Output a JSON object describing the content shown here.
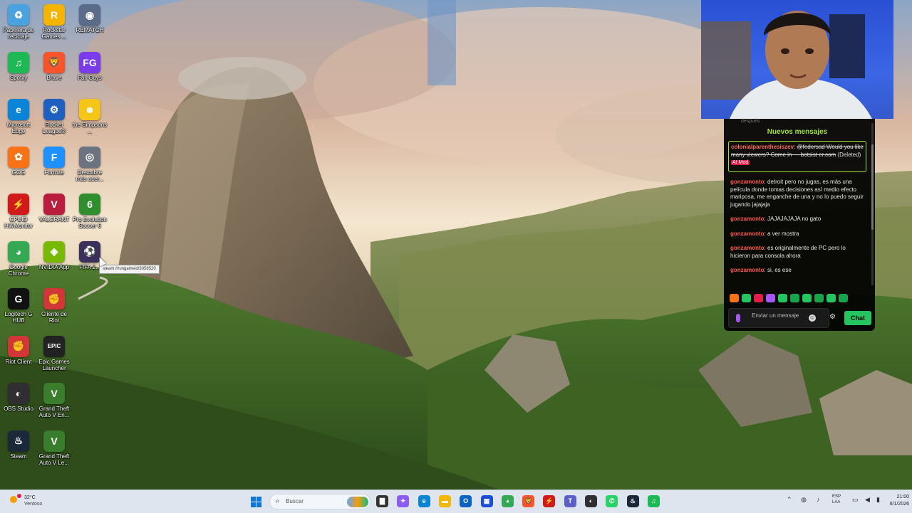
{
  "desktop": {
    "icons": [
      {
        "id": "recycle",
        "label": "Papelera de reciclaje",
        "glyph": "♻",
        "color": "#4aa3df"
      },
      {
        "id": "rockstar",
        "label": "Rockstar Games ...",
        "glyph": "R",
        "color": "#f4b400"
      },
      {
        "id": "rematch",
        "label": "REMATCH",
        "glyph": "◉",
        "color": "#5b6b8a"
      },
      {
        "id": "spotify",
        "label": "Spotify",
        "glyph": "♫",
        "color": "#1db954"
      },
      {
        "id": "brave",
        "label": "Brave",
        "glyph": "🦁",
        "color": "#fb542b"
      },
      {
        "id": "fallguys",
        "label": "Fall Guys",
        "glyph": "FG",
        "color": "#7c3aed"
      },
      {
        "id": "edge",
        "label": "Microsoft Edge",
        "glyph": "e",
        "color": "#0a84d6"
      },
      {
        "id": "rocket",
        "label": "Rocket League®",
        "glyph": "⚙",
        "color": "#1e5fbf"
      },
      {
        "id": "simpsons",
        "label": "the Simpsons ...",
        "glyph": "☻",
        "color": "#f5c518"
      },
      {
        "id": "gog",
        "label": "GOG",
        "glyph": "✿",
        "color": "#f97316"
      },
      {
        "id": "fortnite",
        "label": "Fortnite",
        "glyph": "F",
        "color": "#1e90ff"
      },
      {
        "id": "descubre",
        "label": "Descubre más acer...",
        "glyph": "◎",
        "color": "#6b7280"
      },
      {
        "id": "cpuid",
        "label": "CPUID HWMonitor",
        "glyph": "⚡",
        "color": "#d11b1b"
      },
      {
        "id": "valorant",
        "label": "VALORANT",
        "glyph": "V",
        "color": "#b91c3c"
      },
      {
        "id": "pes",
        "label": "Pro Evolution Soccer 6",
        "glyph": "6",
        "color": "#2f8f2f"
      },
      {
        "id": "chrome",
        "label": "Google Chrome",
        "glyph": "◕",
        "color": "#34a853"
      },
      {
        "id": "nvidia",
        "label": "NVIDIA App",
        "glyph": "◈",
        "color": "#76b900"
      },
      {
        "id": "fifa",
        "label": "FIFA 2...",
        "glyph": "⚽",
        "color": "#3b2f5c"
      },
      {
        "id": "logitech",
        "label": "Logitech G HUB",
        "glyph": "G",
        "color": "#111111"
      },
      {
        "id": "riotcliente",
        "label": "Cliente de Riot",
        "glyph": "✊",
        "color": "#d13639"
      },
      {
        "id": "riot",
        "label": "Riot Client",
        "glyph": "✊",
        "color": "#d13639"
      },
      {
        "id": "epic",
        "label": "Epic Games Launcher",
        "glyph": "EPIC",
        "color": "#222222"
      },
      {
        "id": "obs",
        "label": "OBS Studio",
        "glyph": "◐",
        "color": "#302e31"
      },
      {
        "id": "gta1",
        "label": "Grand Theft Auto V En...",
        "glyph": "V",
        "color": "#3a7d2c"
      },
      {
        "id": "steam",
        "label": "Steam",
        "glyph": "♨",
        "color": "#1b2838"
      },
      {
        "id": "gta2",
        "label": "Grand Theft Auto V Le...",
        "glyph": "V",
        "color": "#3a7d2c"
      }
    ],
    "tooltip": "steam://rungameid/3058520"
  },
  "chat": {
    "top_fade": "después",
    "new_messages_label": "Nuevos mensajes",
    "deleted_message": {
      "user": "colonialparenthesiszev",
      "text": "@federsad Would you like many viewers? Come in — botsist er.com",
      "deleted_tag": "(Deleted)",
      "mod_badge": "AI Mod"
    },
    "messages": [
      {
        "user": "gonzamonto",
        "text": "detroit pero no jugas, es más una película donde tomas decisiones así medio efecto mariposa, me enganche de una y no lo puedo seguir jugando jajajaja"
      },
      {
        "user": "gonzamonto",
        "text": "JAJAJAJAJA no gato"
      },
      {
        "user": "gonzamonto",
        "text": "a ver mostra"
      },
      {
        "user": "gonzamonto",
        "text": "es originalmente de PC pero lo hicieron para consola ahora"
      },
      {
        "user": "gonzamonto",
        "text": "si, es ese"
      }
    ],
    "input_placeholder": "Enviar un mensaje",
    "chat_button": "Chat",
    "accent": "#22c55e"
  },
  "taskbar": {
    "weather_temp": "32°C",
    "weather_desc": "Ventoso",
    "search_placeholder": "Buscar",
    "lang_line1": "ESP",
    "lang_line2": "LAA",
    "time": "21:00",
    "date": "6/1/2026",
    "apps": [
      {
        "name": "file-explorer",
        "glyph": "▇",
        "color": "#333333"
      },
      {
        "name": "copilot",
        "glyph": "✦",
        "color": "#8b5cf6"
      },
      {
        "name": "edge",
        "glyph": "e",
        "color": "#0a84d6"
      },
      {
        "name": "folder",
        "glyph": "▬",
        "color": "#f2b705"
      },
      {
        "name": "outlook",
        "glyph": "O",
        "color": "#0b63c5"
      },
      {
        "name": "store",
        "glyph": "▦",
        "color": "#1d4ed8"
      },
      {
        "name": "chrome",
        "glyph": "◕",
        "color": "#34a853"
      },
      {
        "name": "brave",
        "glyph": "🦁",
        "color": "#fb542b"
      },
      {
        "name": "hwmonitor",
        "glyph": "⚡",
        "color": "#d11b1b"
      },
      {
        "name": "teams",
        "glyph": "T",
        "color": "#5b5fc7"
      },
      {
        "name": "obs",
        "glyph": "◐",
        "color": "#302e31"
      },
      {
        "name": "whatsapp",
        "glyph": "✆",
        "color": "#25d366"
      },
      {
        "name": "steam",
        "glyph": "♨",
        "color": "#1b2838"
      },
      {
        "name": "spotify",
        "glyph": "♫",
        "color": "#1db954"
      }
    ]
  }
}
